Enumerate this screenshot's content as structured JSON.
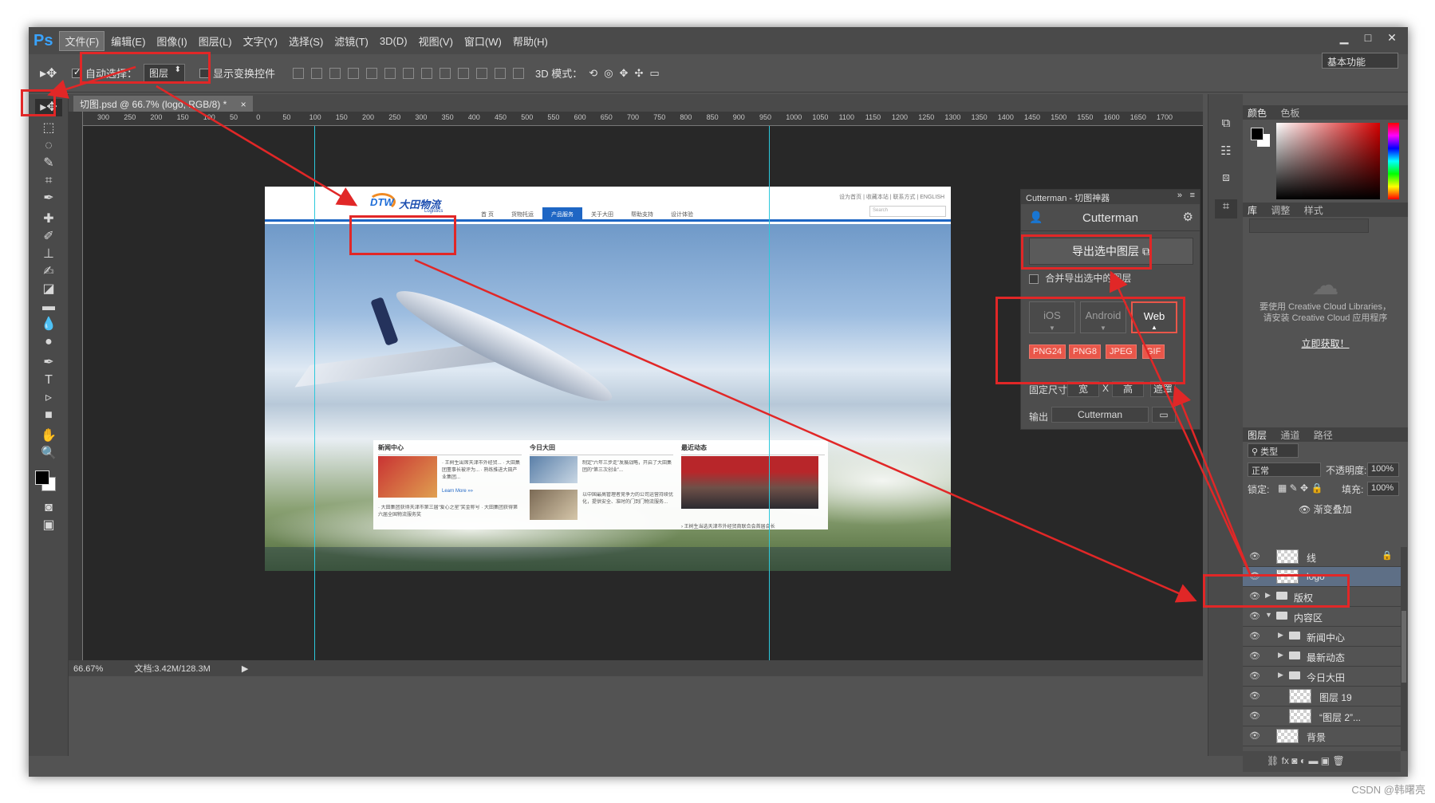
{
  "menubar": {
    "logo": "Ps",
    "items": [
      "文件(F)",
      "编辑(E)",
      "图像(I)",
      "图层(L)",
      "文字(Y)",
      "选择(S)",
      "滤镜(T)",
      "3D(D)",
      "视图(V)",
      "窗口(W)",
      "帮助(H)"
    ],
    "window_controls": [
      "▁",
      "□",
      "✕"
    ]
  },
  "options": {
    "auto_select_label": "自动选择：",
    "auto_select_value": "图层",
    "show_transform_label": "显示变换控件",
    "mode_3d_label": "3D 模式：",
    "workspace": "基本功能"
  },
  "document": {
    "tab_title": "切图.psd @ 66.7% (logo, RGB/8) *",
    "tab_close": "×",
    "ruler_ticks": [
      "300",
      "250",
      "200",
      "150",
      "100",
      "50",
      "0",
      "50",
      "100",
      "150",
      "200",
      "250",
      "300",
      "350",
      "400",
      "450",
      "500",
      "550",
      "600",
      "650",
      "700",
      "750",
      "800",
      "850",
      "900",
      "950",
      "1000",
      "1050",
      "1100",
      "1150",
      "1200",
      "1250",
      "1300",
      "1350",
      "1400",
      "1450",
      "1500",
      "1550",
      "1600",
      "1650",
      "1700"
    ],
    "zoom": "66.67%",
    "doc_info": "文档:3.42M/128.3M"
  },
  "site": {
    "logo_dtw": "DTW",
    "logo_cn": "大田物流",
    "logo_en": "Logistics",
    "top_links": "设为首页 | 收藏本站 | 联系方式 | ENGLISH",
    "nav": [
      "首 页",
      "货物托运",
      "产品服务",
      "关于大田",
      "帮助支持",
      "设计体验"
    ],
    "search_placeholder": "Search",
    "col1_title": "新闻中心",
    "col1_text": "· 王树生出席天津市外经贸... · 大田集团董事长被评为... · 熟练推进大田产业集团...",
    "col1_more": "Learn More »»",
    "col1_links": "· 大田集团获得天津市第三届“爱心之星”奖金称号 · 大田集团获得第六届全国物流服务奖",
    "col2_title": "今日大田",
    "col2_text1": "制定“六年三步走”发展战略，开启了大田集团的“第三次创业”...",
    "col2_text2": "以中国最高管理者竞争力的公司运营持续优化，提供安全、准时的门到门物流服务...",
    "col3_title": "最近动态",
    "col3_caption": "› 王树生当选天津市外经贸商联合会首届会长"
  },
  "cutterman": {
    "panel_title": "Cutterman - 切图神器",
    "header": "Cutterman",
    "export_button": "导出选中图层",
    "merge_label": "合并导出选中的图层",
    "platforms": [
      "iOS",
      "Android",
      "Web"
    ],
    "formats": [
      "PNG24",
      "PNG8",
      "JPEG",
      "GIF"
    ],
    "fixed_size_label": "固定尺寸",
    "width_label": "宽",
    "x_label": "X",
    "height_label": "高",
    "mask_label": "遮罩",
    "output_label": "输出",
    "output_value": "Cutterman"
  },
  "color_panel": {
    "tabs": [
      "颜色",
      "色板"
    ]
  },
  "library_panel": {
    "tabs": [
      "库",
      "调整",
      "样式"
    ],
    "message_line1": "要使用 Creative Cloud Libraries，",
    "message_line2": "请安装 Creative Cloud 应用程序",
    "link": "立即获取！"
  },
  "layers_panel": {
    "tabs": [
      "图层",
      "通道",
      "路径"
    ],
    "filter_label": "类型",
    "blend_mode": "正常",
    "opacity_label": "不透明度:",
    "opacity_value": "100%",
    "lock_label": "锁定:",
    "fill_label": "填充:",
    "fill_value": "100%",
    "effect_label": "渐变叠加",
    "layers": [
      {
        "name": "线",
        "kind": "pixel",
        "indent": 0,
        "locked": true
      },
      {
        "name": "logo",
        "kind": "pixel",
        "indent": 0,
        "selected": true
      },
      {
        "name": "版权",
        "kind": "group",
        "indent": 0
      },
      {
        "name": "内容区",
        "kind": "group",
        "indent": 0,
        "open": true
      },
      {
        "name": "新闻中心",
        "kind": "group",
        "indent": 1
      },
      {
        "name": "最新动态",
        "kind": "group",
        "indent": 1
      },
      {
        "name": "今日大田",
        "kind": "group",
        "indent": 1
      },
      {
        "name": "图层 19",
        "kind": "pixel",
        "indent": 1
      },
      {
        "name": "“图层 2”...",
        "kind": "masked",
        "indent": 1
      },
      {
        "name": "背景",
        "kind": "image",
        "indent": 0
      }
    ]
  },
  "watermark": "CSDN @韩曙亮"
}
